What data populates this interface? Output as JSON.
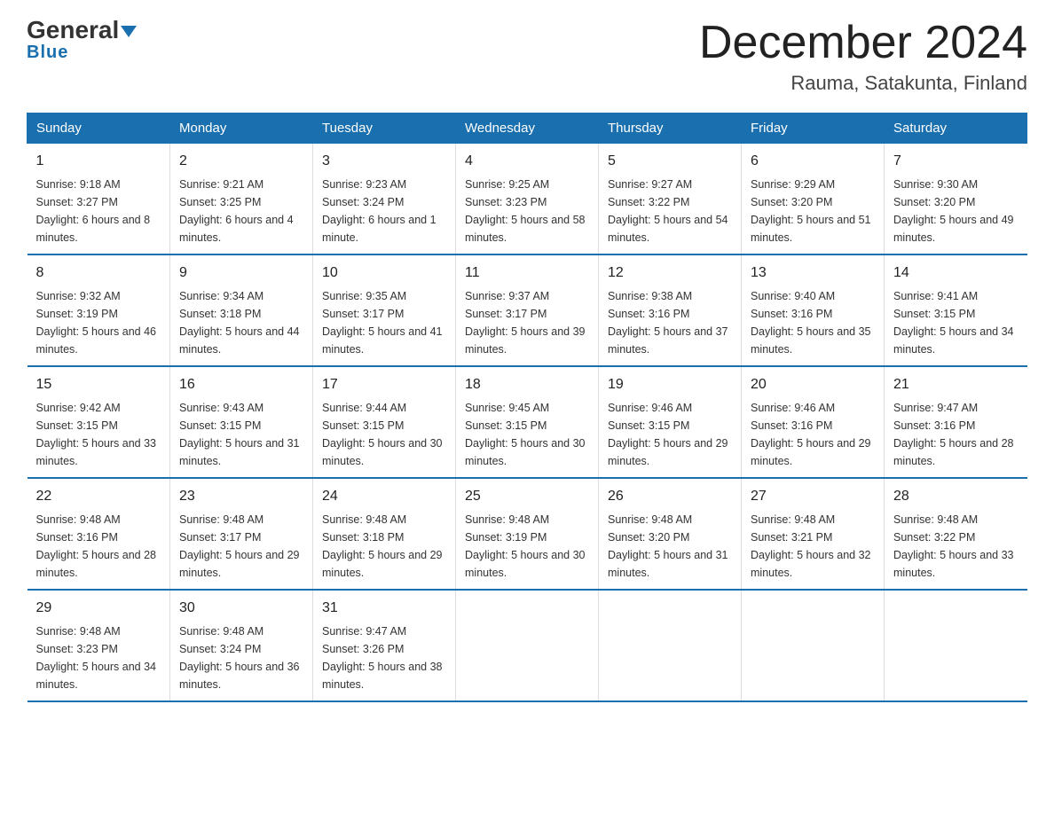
{
  "logo": {
    "line1": "General",
    "line2": "Blue"
  },
  "title": "December 2024",
  "subtitle": "Rauma, Satakunta, Finland",
  "days_of_week": [
    "Sunday",
    "Monday",
    "Tuesday",
    "Wednesday",
    "Thursday",
    "Friday",
    "Saturday"
  ],
  "weeks": [
    [
      {
        "day": "1",
        "sunrise": "9:18 AM",
        "sunset": "3:27 PM",
        "daylight": "6 hours and 8 minutes."
      },
      {
        "day": "2",
        "sunrise": "9:21 AM",
        "sunset": "3:25 PM",
        "daylight": "6 hours and 4 minutes."
      },
      {
        "day": "3",
        "sunrise": "9:23 AM",
        "sunset": "3:24 PM",
        "daylight": "6 hours and 1 minute."
      },
      {
        "day": "4",
        "sunrise": "9:25 AM",
        "sunset": "3:23 PM",
        "daylight": "5 hours and 58 minutes."
      },
      {
        "day": "5",
        "sunrise": "9:27 AM",
        "sunset": "3:22 PM",
        "daylight": "5 hours and 54 minutes."
      },
      {
        "day": "6",
        "sunrise": "9:29 AM",
        "sunset": "3:20 PM",
        "daylight": "5 hours and 51 minutes."
      },
      {
        "day": "7",
        "sunrise": "9:30 AM",
        "sunset": "3:20 PM",
        "daylight": "5 hours and 49 minutes."
      }
    ],
    [
      {
        "day": "8",
        "sunrise": "9:32 AM",
        "sunset": "3:19 PM",
        "daylight": "5 hours and 46 minutes."
      },
      {
        "day": "9",
        "sunrise": "9:34 AM",
        "sunset": "3:18 PM",
        "daylight": "5 hours and 44 minutes."
      },
      {
        "day": "10",
        "sunrise": "9:35 AM",
        "sunset": "3:17 PM",
        "daylight": "5 hours and 41 minutes."
      },
      {
        "day": "11",
        "sunrise": "9:37 AM",
        "sunset": "3:17 PM",
        "daylight": "5 hours and 39 minutes."
      },
      {
        "day": "12",
        "sunrise": "9:38 AM",
        "sunset": "3:16 PM",
        "daylight": "5 hours and 37 minutes."
      },
      {
        "day": "13",
        "sunrise": "9:40 AM",
        "sunset": "3:16 PM",
        "daylight": "5 hours and 35 minutes."
      },
      {
        "day": "14",
        "sunrise": "9:41 AM",
        "sunset": "3:15 PM",
        "daylight": "5 hours and 34 minutes."
      }
    ],
    [
      {
        "day": "15",
        "sunrise": "9:42 AM",
        "sunset": "3:15 PM",
        "daylight": "5 hours and 33 minutes."
      },
      {
        "day": "16",
        "sunrise": "9:43 AM",
        "sunset": "3:15 PM",
        "daylight": "5 hours and 31 minutes."
      },
      {
        "day": "17",
        "sunrise": "9:44 AM",
        "sunset": "3:15 PM",
        "daylight": "5 hours and 30 minutes."
      },
      {
        "day": "18",
        "sunrise": "9:45 AM",
        "sunset": "3:15 PM",
        "daylight": "5 hours and 30 minutes."
      },
      {
        "day": "19",
        "sunrise": "9:46 AM",
        "sunset": "3:15 PM",
        "daylight": "5 hours and 29 minutes."
      },
      {
        "day": "20",
        "sunrise": "9:46 AM",
        "sunset": "3:16 PM",
        "daylight": "5 hours and 29 minutes."
      },
      {
        "day": "21",
        "sunrise": "9:47 AM",
        "sunset": "3:16 PM",
        "daylight": "5 hours and 28 minutes."
      }
    ],
    [
      {
        "day": "22",
        "sunrise": "9:48 AM",
        "sunset": "3:16 PM",
        "daylight": "5 hours and 28 minutes."
      },
      {
        "day": "23",
        "sunrise": "9:48 AM",
        "sunset": "3:17 PM",
        "daylight": "5 hours and 29 minutes."
      },
      {
        "day": "24",
        "sunrise": "9:48 AM",
        "sunset": "3:18 PM",
        "daylight": "5 hours and 29 minutes."
      },
      {
        "day": "25",
        "sunrise": "9:48 AM",
        "sunset": "3:19 PM",
        "daylight": "5 hours and 30 minutes."
      },
      {
        "day": "26",
        "sunrise": "9:48 AM",
        "sunset": "3:20 PM",
        "daylight": "5 hours and 31 minutes."
      },
      {
        "day": "27",
        "sunrise": "9:48 AM",
        "sunset": "3:21 PM",
        "daylight": "5 hours and 32 minutes."
      },
      {
        "day": "28",
        "sunrise": "9:48 AM",
        "sunset": "3:22 PM",
        "daylight": "5 hours and 33 minutes."
      }
    ],
    [
      {
        "day": "29",
        "sunrise": "9:48 AM",
        "sunset": "3:23 PM",
        "daylight": "5 hours and 34 minutes."
      },
      {
        "day": "30",
        "sunrise": "9:48 AM",
        "sunset": "3:24 PM",
        "daylight": "5 hours and 36 minutes."
      },
      {
        "day": "31",
        "sunrise": "9:47 AM",
        "sunset": "3:26 PM",
        "daylight": "5 hours and 38 minutes."
      },
      null,
      null,
      null,
      null
    ]
  ]
}
